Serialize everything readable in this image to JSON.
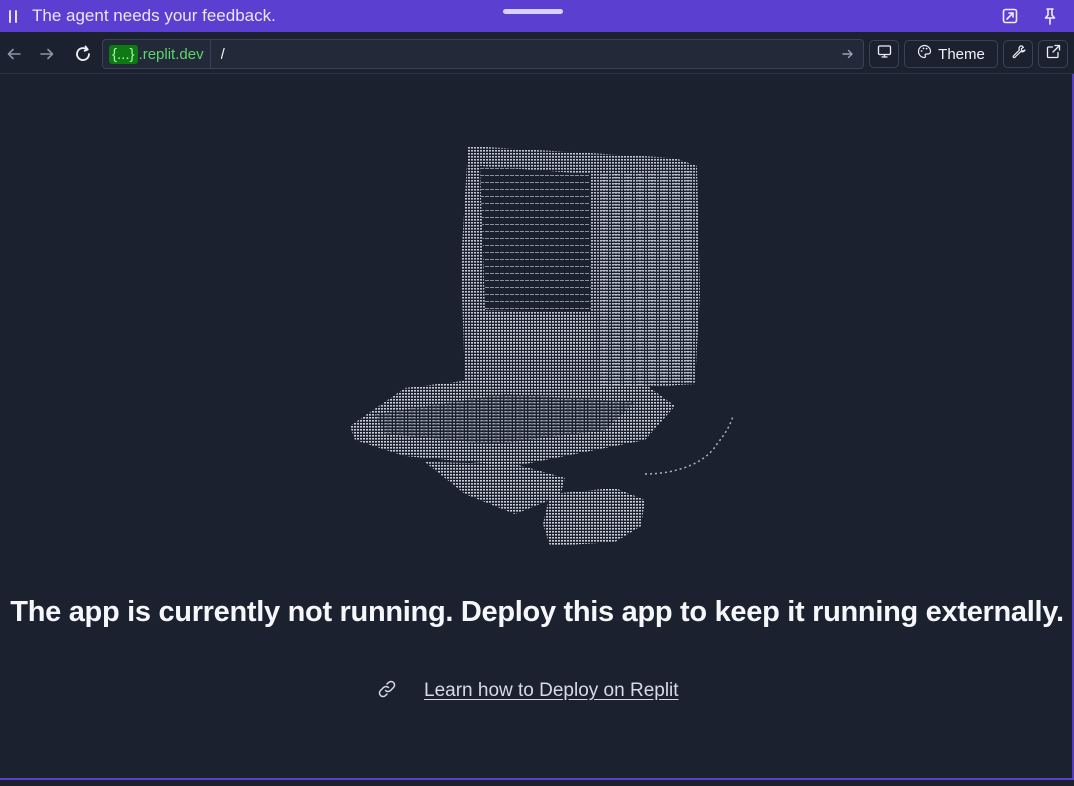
{
  "banner": {
    "message": "The agent needs your feedback.",
    "icons": [
      "drag-grip-icon",
      "expand-icon",
      "pin-icon"
    ]
  },
  "toolbar": {
    "host_tag": "{...}",
    "host_domain": ".replit.dev",
    "path_value": "/",
    "theme_label": "Theme",
    "icons": [
      "back-arrow-icon",
      "forward-arrow-icon",
      "reload-icon",
      "go-arrow-icon",
      "devices-icon",
      "palette-icon",
      "wrench-icon",
      "external-link-icon"
    ]
  },
  "main": {
    "headline": "The app is currently not running. Deploy this app to keep it running externally.",
    "link_label": "Learn how to Deploy on Replit",
    "art": "ascii-art-image"
  },
  "colors": {
    "banner": "#5a3fd0",
    "background": "#1c2130",
    "host_green": "#5cd66a"
  }
}
